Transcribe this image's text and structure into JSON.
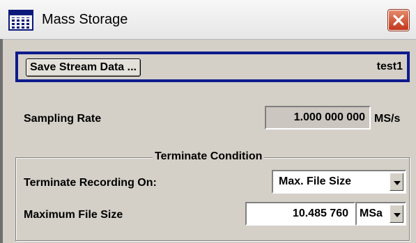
{
  "window": {
    "title": "Mass Storage",
    "icon": "data-table-icon",
    "close_icon": "close-icon"
  },
  "stream": {
    "save_button_label": "Save Stream Data ...",
    "name": "test1"
  },
  "sampling": {
    "label": "Sampling Rate",
    "value": "1.000 000 000",
    "unit": "MS/s"
  },
  "terminate": {
    "group_title": "Terminate Condition",
    "recording_label": "Terminate Recording On:",
    "recording_value": "Max. File Size",
    "max_size_label": "Maximum File Size",
    "max_size_value": "10.485 760",
    "max_size_unit": "MSa"
  },
  "colors": {
    "stream_border": "#0d1b8c",
    "close_button": "#c2361b",
    "dialog_bg": "#d4d0c8"
  }
}
